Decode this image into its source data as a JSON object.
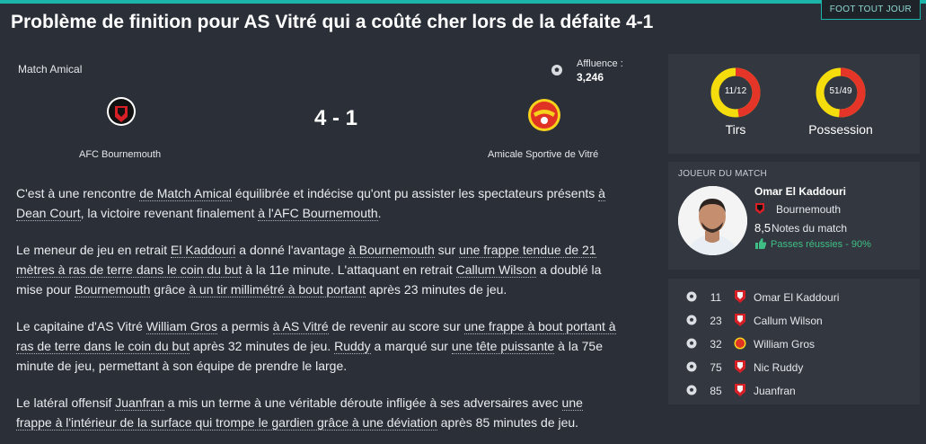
{
  "header": {
    "category_tag": "FOOT TOUT JOUR",
    "headline": "Problème de finition pour AS Vitré qui a coûté cher lors de la défaite 4-1"
  },
  "match": {
    "type": "Match Amical",
    "attendance_label": "Affluence :",
    "attendance_value": "3,246",
    "score": "4 - 1",
    "home_team": "AFC Bournemouth",
    "away_team": "Amicale Sportive de Vitré"
  },
  "article": {
    "p1": [
      "C'est à une rencontre ",
      "de Match Amical",
      " équilibrée et indécise qu'ont pu assister les spectateurs présents ",
      "à",
      "Dean Court",
      ", la victoire revenant finalement ",
      "à l'AFC Bournemouth",
      "."
    ],
    "p2": [
      "Le meneur de jeu en retrait ",
      "El Kaddouri",
      " a donné l'avantage ",
      "à Bournemouth",
      " sur ",
      "une frappe tendue de 21",
      "mètres à ras de terre dans le coin du but",
      " à la 11e minute. L'attaquant en retrait ",
      "Callum Wilson",
      " a doublé la",
      "mise pour ",
      "Bournemouth",
      " grâce ",
      "à un tir millimétré à bout portant",
      " après 23 minutes de jeu."
    ],
    "p3": [
      "Le capitaine d'AS Vitré ",
      "William Gros",
      " a permis ",
      "à AS Vitré",
      " de revenir au score sur ",
      "une frappe à bout portant à",
      "ras de terre dans le coin du but",
      " après 32 minutes de jeu. ",
      "Ruddy",
      " a marqué sur ",
      "une tête puissante",
      " à la 75e",
      "minute de jeu, permettant à son équipe de prendre le large."
    ],
    "p4": [
      "Le latéral offensif ",
      "Juanfran",
      " a mis un terme à une véritable déroute infligée à ses adversaires avec ",
      "une",
      "frappe à l'intérieur de la surface qui trompe le gardien grâce à une déviation",
      " après 85 minutes de jeu."
    ]
  },
  "stats": {
    "shots": {
      "value": "11/12",
      "label": "Tirs",
      "home": 11,
      "away": 12
    },
    "possession": {
      "value": "51/49",
      "label": "Possession",
      "home": 51,
      "away": 49
    }
  },
  "motm": {
    "title": "JOUEUR DU MATCH",
    "name": "Omar El Kaddouri",
    "club": "Bournemouth",
    "rating": "8,5",
    "rating_label": "Notes du match",
    "highlight": "Passes réussies - 90%"
  },
  "goals": [
    {
      "minute": "11",
      "player": "Omar El Kaddouri",
      "team": "home"
    },
    {
      "minute": "23",
      "player": "Callum Wilson",
      "team": "home"
    },
    {
      "minute": "32",
      "player": "William Gros",
      "team": "away"
    },
    {
      "minute": "75",
      "player": "Nic Ruddy",
      "team": "home"
    },
    {
      "minute": "85",
      "player": "Juanfran",
      "team": "home"
    }
  ],
  "colors": {
    "accent": "#1bb6a9",
    "home_stat": "#e53528",
    "away_stat": "#f5dc0c",
    "positive": "#3fbf85"
  }
}
